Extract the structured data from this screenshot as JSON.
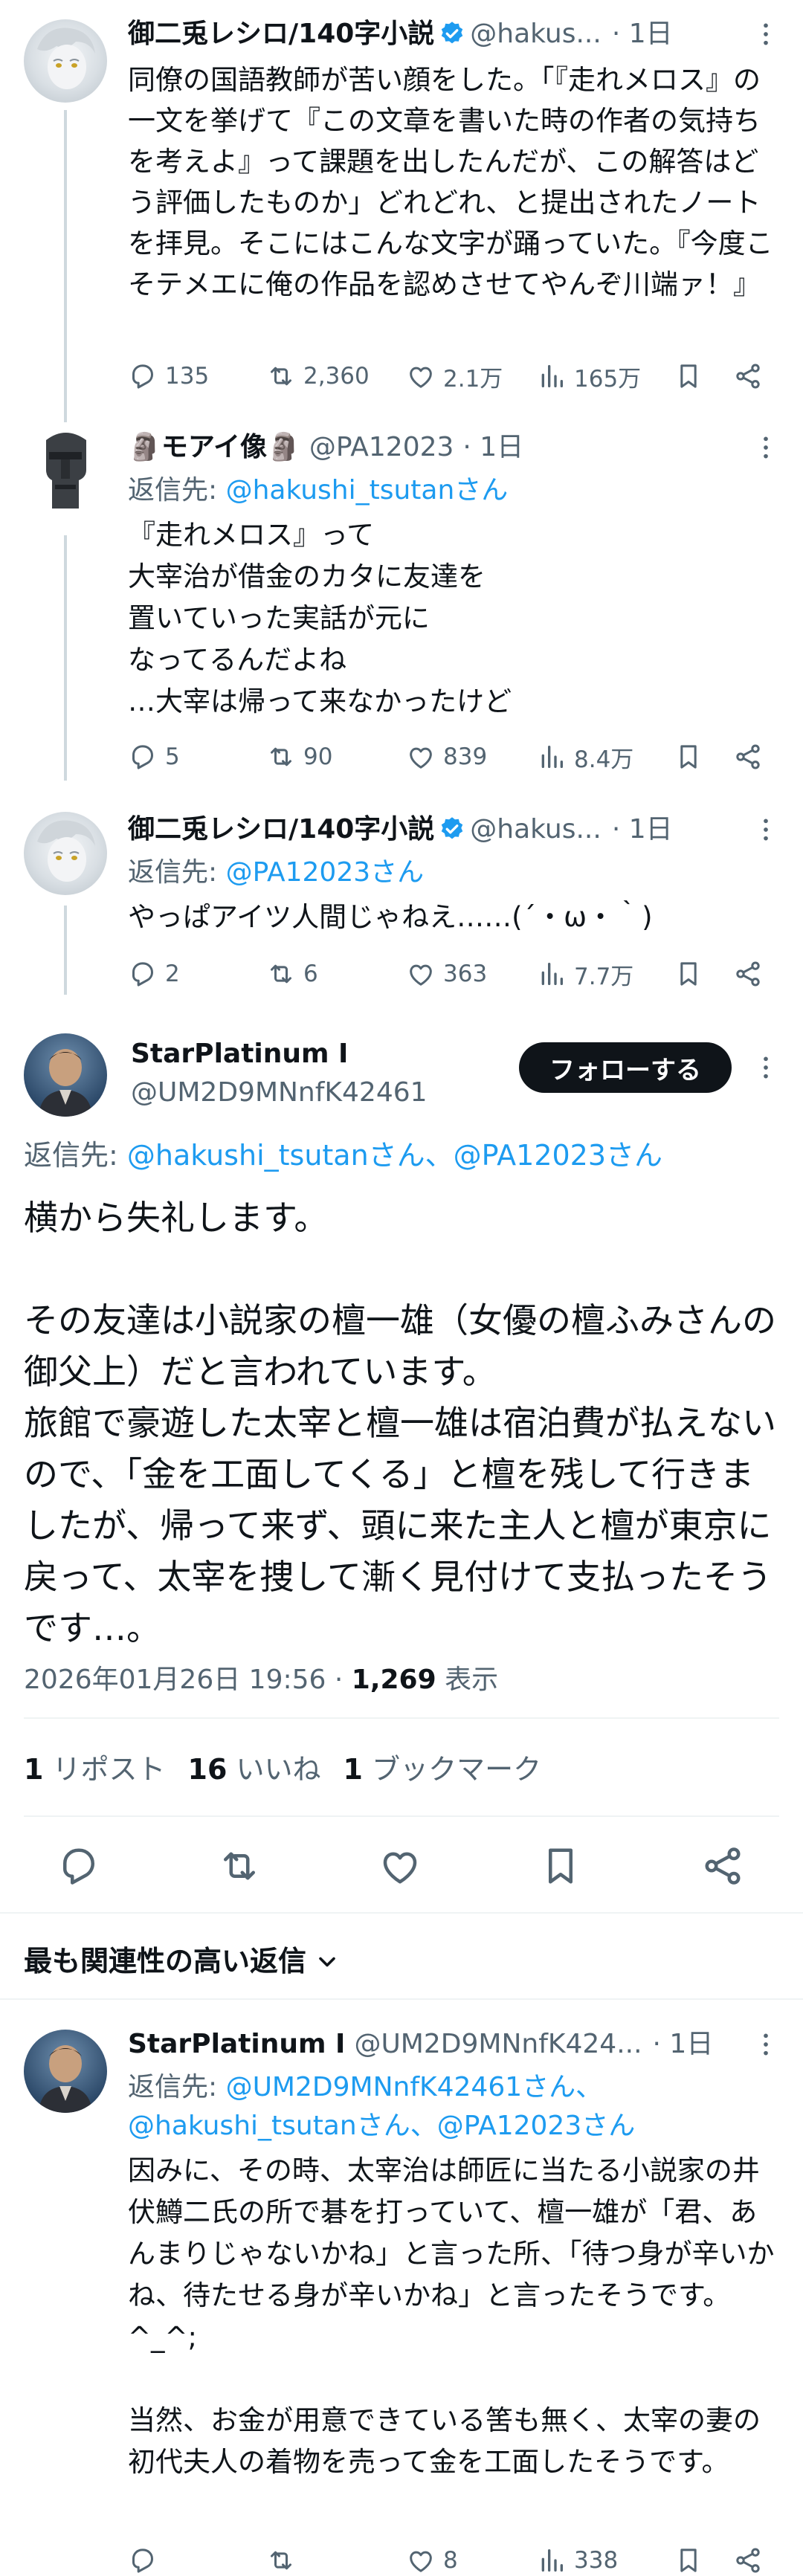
{
  "tweets": [
    {
      "name": "御二兎レシロ/140字小説",
      "handle": "@hakus...",
      "time": "· 1日",
      "text": "同僚の国語教師が苦い顔をした。「『走れメロス』の一文を挙げて『この文章を書いた時の作者の気持ちを考えよ』って課題を出したんだが、この解答はどう評価したものか」どれどれ、と提出されたノートを拝見。そこにはこんな文字が踊っていた。『今度こそテメエに俺の作品を認めさせてやんぞ川端ァ！』",
      "replies": "135",
      "retweets": "2,360",
      "likes": "2.1万",
      "views": "165万"
    },
    {
      "name_prefix": "🗿",
      "name": "モアイ像",
      "name_suffix": "🗿",
      "handle": "@PA12023",
      "time": "· 1日",
      "reply_label": "返信先: ",
      "reply_to": "@hakushi_tsutanさん",
      "text": "『走れメロス』って\n大宰治が借金のカタに友達を\n置いていった実話が元に\nなってるんだよね\n…大宰は帰って来なかったけど",
      "replies": "5",
      "retweets": "90",
      "likes": "839",
      "views": "8.4万"
    },
    {
      "name": "御二兎レシロ/140字小説",
      "handle": "@hakus...",
      "time": "· 1日",
      "reply_label": "返信先: ",
      "reply_to": "@PA12023さん",
      "text": "やっぱアイツ人間じゃねえ……(´・ω・｀)",
      "replies": "2",
      "retweets": "6",
      "likes": "363",
      "views": "7.7万"
    }
  ],
  "main": {
    "name": "StarPlatinum I",
    "handle": "@UM2D9MNnfK42461",
    "follow_label": "フォローする",
    "reply_label": "返信先: ",
    "reply_to": "@hakushi_tsutanさん、@PA12023さん",
    "text": "横から失礼します。\n\nその友達は小説家の檀一雄（女優の檀ふみさんの御父上）だと言われています。\n旅館で豪遊した太宰と檀一雄は宿泊費が払えないので、「金を工面してくる」と檀を残して行きましたが、帰って来ず、頭に来た主人と檀が東京に戻って、太宰を捜して漸く見付けて支払ったそうです…。",
    "timestamp": "2026年01月26日 19:56 · ",
    "views_count": "1,269",
    "views_label": " 表示",
    "reposts_count": "1",
    "reposts_label": " リポスト",
    "likes_count": "16",
    "likes_label": " いいね",
    "bookmarks_count": "1",
    "bookmarks_label": " ブックマーク"
  },
  "sort": {
    "label": "最も関連性の高い返信"
  },
  "reply": {
    "name": "StarPlatinum I",
    "handle": "@UM2D9MNnfK424...",
    "time": "· 1日",
    "reply_label": "返信先: ",
    "reply_to_line1": "@UM2D9MNnfK42461さん、",
    "reply_to_line2": "@hakushi_tsutanさん、@PA12023さん",
    "text": "因みに、その時、太宰治は師匠に当たる小説家の井伏鱒二氏の所で碁を打っていて、檀一雄が「君、あんまりじゃないかね」と言った所、「待つ身が辛いかね、待たせる身が辛いかね」と言ったそうです。^_^;\n\n当然、お金が用意できている筈も無く、太宰の妻の初代夫人の着物を売って金を工面したそうです。",
    "replies": "",
    "retweets": "",
    "likes": "8",
    "views": "338"
  },
  "colors": {
    "text": "#0f1419",
    "secondary": "#536471",
    "link": "#1d9bf0",
    "divider": "#eff3f4",
    "thread_line": "#cfd9de",
    "follow_bg": "#0f1419"
  },
  "icons": [
    "verified-badge-icon",
    "more-dots-icon",
    "reply-icon",
    "retweet-icon",
    "like-icon",
    "views-icon",
    "bookmark-icon",
    "share-icon",
    "chevron-down-icon"
  ]
}
